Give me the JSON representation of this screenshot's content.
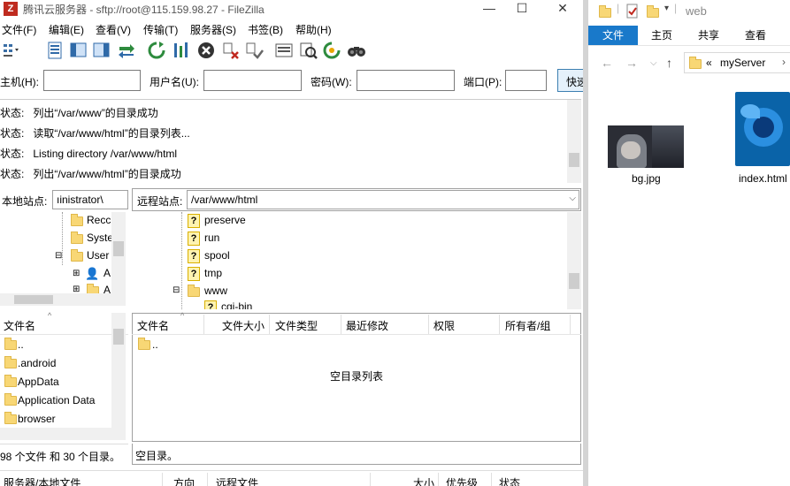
{
  "filezilla": {
    "title": "腾讯云服务器 - sftp://root@115.159.98.27 - FileZilla",
    "window_buttons": [
      "—",
      "☐",
      "✕"
    ],
    "menu": [
      "文件(F)",
      "编辑(E)",
      "查看(V)",
      "传输(T)",
      "服务器(S)",
      "书签(B)",
      "帮助(H)"
    ],
    "quickconnect": {
      "host_label": "主机(H):",
      "user_label": "用户名(U):",
      "pass_label": "密码(W):",
      "port_label": "端口(P):",
      "button_label": "快速"
    },
    "log": [
      {
        "prefix": "状态:",
        "text": "列出“/var/www”的目录成功"
      },
      {
        "prefix": "状态:",
        "text": "读取“/var/www/html”的目录列表..."
      },
      {
        "prefix": "状态:",
        "text": "Listing directory /var/www/html"
      },
      {
        "prefix": "状态:",
        "text": "列出“/var/www/html”的目录成功"
      }
    ],
    "local": {
      "site_label": "本地站点:",
      "site_value": "ıinistrator\\",
      "tree": [
        "Recc",
        "Syste",
        "User",
        "A",
        "A"
      ],
      "columns": [
        "文件名"
      ],
      "files": [
        "..",
        ".android",
        "AppData",
        "Application Data",
        "browser"
      ],
      "status": "98 个文件 和 30 个目录。"
    },
    "remote": {
      "site_label": "远程站点:",
      "site_value": "/var/www/html",
      "tree": [
        "preserve",
        "run",
        "spool",
        "tmp",
        "www",
        "cgi-bin"
      ],
      "columns": [
        "文件名",
        "文件大小",
        "文件类型",
        "最近修改",
        "权限",
        "所有者/组"
      ],
      "files": [
        ".."
      ],
      "empty_text": "空目录列表",
      "status": "空目录。"
    },
    "queue_columns": [
      "服务器/本地文件",
      "方向",
      "远程文件",
      "大小",
      "优先级",
      "状态"
    ]
  },
  "explorer": {
    "title": "web",
    "tabs": [
      "文件",
      "主页",
      "共享",
      "查看"
    ],
    "breadcrumb_prefix": "«",
    "breadcrumb": "myServer",
    "files": [
      {
        "name": "bg.jpg",
        "icon": "image-thumbnail"
      },
      {
        "name": "index.html",
        "icon": "firefox-html-icon"
      }
    ]
  }
}
